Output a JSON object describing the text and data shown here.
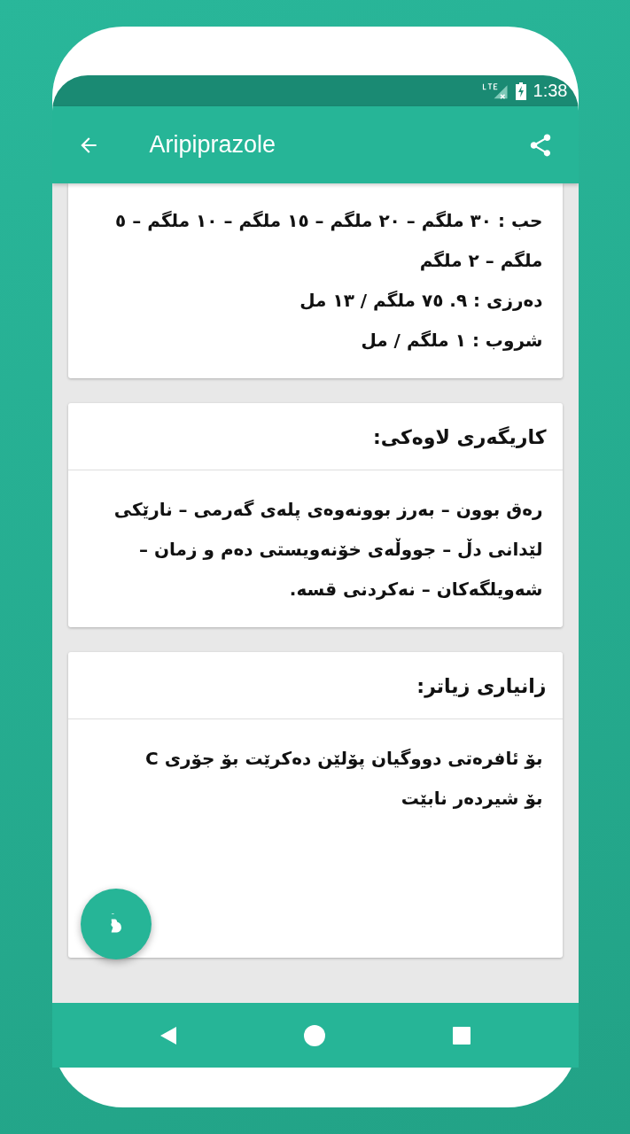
{
  "status_bar": {
    "time": "1:38"
  },
  "app_bar": {
    "title": "Aripiprazole"
  },
  "cards": [
    {
      "lines": [
        "حب : ٣٠ ملگم – ٢٠ ملگم – ١٥ ملگم – ١٠ ملگم – ٥ ملگم – ٢ ملگم",
        "دەرزی : ٩. ٧٥ ملگم / ١٣ مل",
        "شروب : ١ ملگم / مل"
      ]
    },
    {
      "title": "کاریگەری لاوەکی:",
      "lines": [
        "رەق بوون – بەرز بوونەوەی پلەی گەرمی – نارێکی لێدانی دڵ – جووڵەی خۆنەویستی دەم و زمان – شەویلگەکان – نەکردنی قسە."
      ]
    },
    {
      "title": "زانیاری زیاتر:",
      "lines": [
        "بۆ ئافرەتی دووگیان پۆلێن دەکرێت بۆ جۆری C",
        "بۆ شیردەر نابێت"
      ]
    }
  ]
}
